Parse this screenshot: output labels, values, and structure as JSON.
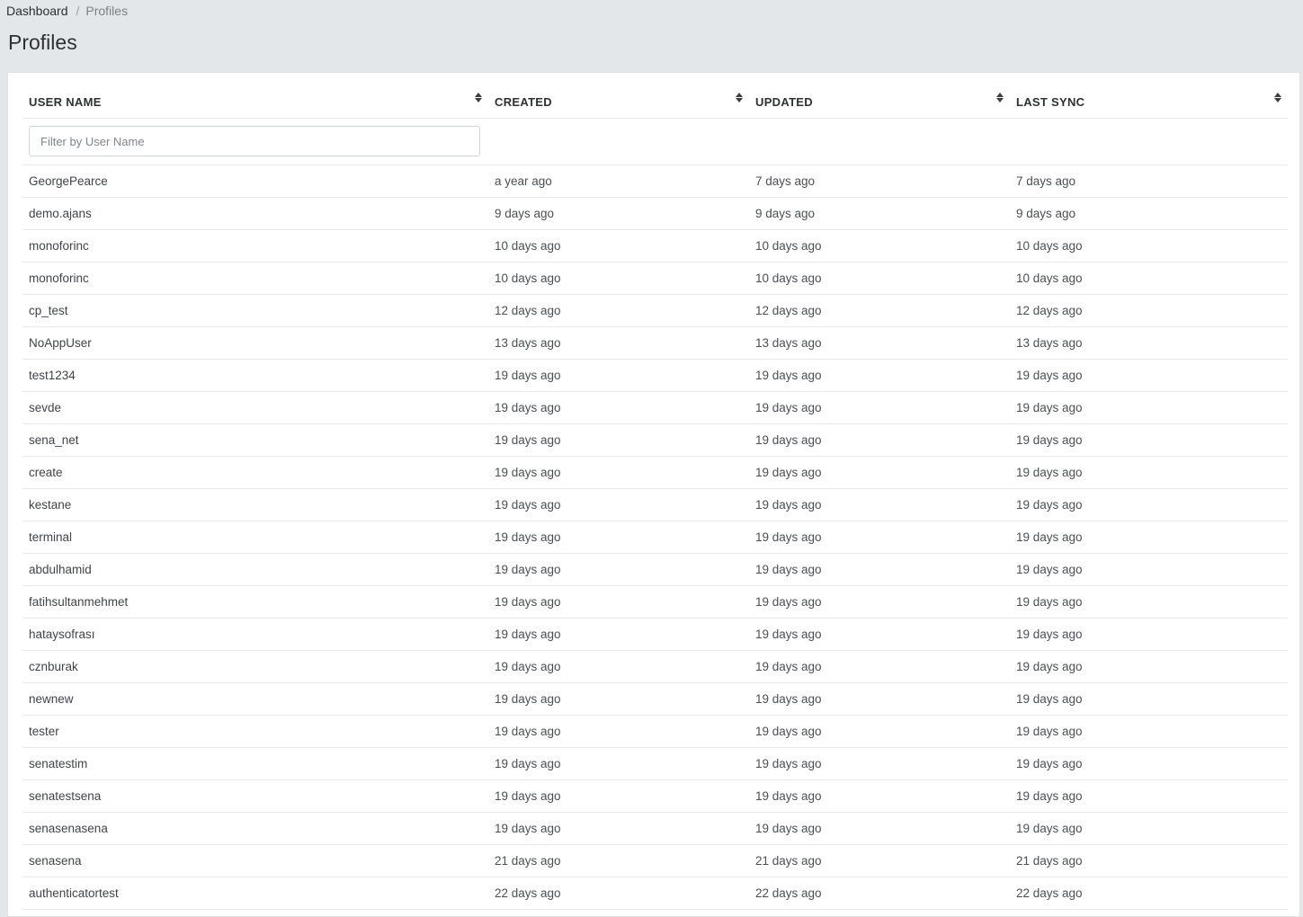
{
  "breadcrumb": {
    "home": "Dashboard",
    "separator": "/",
    "current": "Profiles"
  },
  "page": {
    "title": "Profiles"
  },
  "table": {
    "columns": [
      "USER NAME",
      "CREATED",
      "UPDATED",
      "LAST SYNC"
    ],
    "filter": {
      "placeholder": "Filter by User Name",
      "value": ""
    },
    "rows": [
      {
        "user": "GeorgePearce",
        "created": "a year ago",
        "updated": "7 days ago",
        "last_sync": "7 days ago"
      },
      {
        "user": "demo.ajans",
        "created": "9 days ago",
        "updated": "9 days ago",
        "last_sync": "9 days ago"
      },
      {
        "user": "monoforinc",
        "created": "10 days ago",
        "updated": "10 days ago",
        "last_sync": "10 days ago"
      },
      {
        "user": "monoforinc",
        "created": "10 days ago",
        "updated": "10 days ago",
        "last_sync": "10 days ago"
      },
      {
        "user": "cp_test",
        "created": "12 days ago",
        "updated": "12 days ago",
        "last_sync": "12 days ago"
      },
      {
        "user": "NoAppUser",
        "created": "13 days ago",
        "updated": "13 days ago",
        "last_sync": "13 days ago"
      },
      {
        "user": "test1234",
        "created": "19 days ago",
        "updated": "19 days ago",
        "last_sync": "19 days ago"
      },
      {
        "user": "sevde",
        "created": "19 days ago",
        "updated": "19 days ago",
        "last_sync": "19 days ago"
      },
      {
        "user": "sena_net",
        "created": "19 days ago",
        "updated": "19 days ago",
        "last_sync": "19 days ago"
      },
      {
        "user": "create",
        "created": "19 days ago",
        "updated": "19 days ago",
        "last_sync": "19 days ago"
      },
      {
        "user": "kestane",
        "created": "19 days ago",
        "updated": "19 days ago",
        "last_sync": "19 days ago"
      },
      {
        "user": "terminal",
        "created": "19 days ago",
        "updated": "19 days ago",
        "last_sync": "19 days ago"
      },
      {
        "user": "abdulhamid",
        "created": "19 days ago",
        "updated": "19 days ago",
        "last_sync": "19 days ago"
      },
      {
        "user": "fatihsultanmehmet",
        "created": "19 days ago",
        "updated": "19 days ago",
        "last_sync": "19 days ago"
      },
      {
        "user": "hataysofrası",
        "created": "19 days ago",
        "updated": "19 days ago",
        "last_sync": "19 days ago"
      },
      {
        "user": "cznburak",
        "created": "19 days ago",
        "updated": "19 days ago",
        "last_sync": "19 days ago"
      },
      {
        "user": "newnew",
        "created": "19 days ago",
        "updated": "19 days ago",
        "last_sync": "19 days ago"
      },
      {
        "user": "tester",
        "created": "19 days ago",
        "updated": "19 days ago",
        "last_sync": "19 days ago"
      },
      {
        "user": "senatestim",
        "created": "19 days ago",
        "updated": "19 days ago",
        "last_sync": "19 days ago"
      },
      {
        "user": "senatestsena",
        "created": "19 days ago",
        "updated": "19 days ago",
        "last_sync": "19 days ago"
      },
      {
        "user": "senasenasena",
        "created": "19 days ago",
        "updated": "19 days ago",
        "last_sync": "19 days ago"
      },
      {
        "user": "senasena",
        "created": "21 days ago",
        "updated": "21 days ago",
        "last_sync": "21 days ago"
      },
      {
        "user": "authenticatortest",
        "created": "22 days ago",
        "updated": "22 days ago",
        "last_sync": "22 days ago"
      }
    ]
  },
  "icons": {
    "sort": "sort-arrows-icon"
  },
  "colors": {
    "background": "#e4e7e9",
    "card": "#ffffff",
    "text": "#3c4043"
  }
}
